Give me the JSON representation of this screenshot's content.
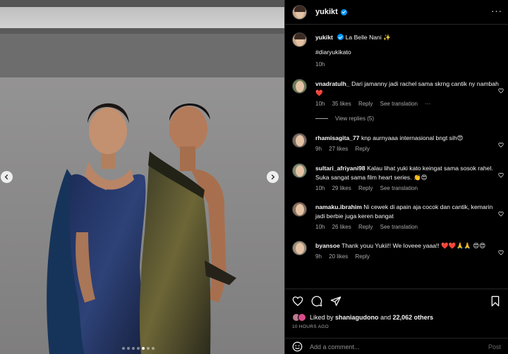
{
  "post": {
    "username": "yukikt",
    "more_icon": "more-horizontal-icon",
    "caption_line1": "La Belle Nani ✨",
    "caption_line2": "#diaryukikato",
    "caption_time": "10h"
  },
  "media": {
    "alt": "Two women in gowns posing",
    "carousel_total": 7,
    "carousel_active": 4
  },
  "comments": [
    {
      "user": "vnadratulh_",
      "text": "Dari jamanny jadi rachel sama skrng cantik ny nambah ❤️",
      "time": "10h",
      "likes": "35 likes",
      "reply": "Reply",
      "translate": "See translation",
      "more": "···",
      "view_replies": "View replies (5)"
    },
    {
      "user": "rhamisagita_77",
      "text": "knp aurnyaaa internasional bngt sih😍",
      "time": "9h",
      "likes": "27 likes",
      "reply": "Reply"
    },
    {
      "user": "sultari_afriyani98",
      "text": "Kalau lihat yuki kato keingat sama sosok rahel. Suka sangat sama film heart series. 👏😍",
      "time": "10h",
      "likes": "29 likes",
      "reply": "Reply",
      "translate": "See translation"
    },
    {
      "user": "namaku.ibrahim",
      "text": "Ni cewek di apain aja cocok dan cantik, kemarin jadi berbie juga keren bangat",
      "time": "10h",
      "likes": "26 likes",
      "reply": "Reply",
      "translate": "See translation"
    },
    {
      "user": "byansoe",
      "text": "Thank youu Yukii!! We loveee yaaa!! ❤️❤️🙏🙏 😍😍",
      "time": "9h",
      "likes": "20 likes",
      "reply": "Reply"
    }
  ],
  "actions": {
    "liked_prefix": "Liked by",
    "liked_user": "shaniagudono",
    "liked_and": "and",
    "liked_count": "22,062 others",
    "timestamp": "10 HOURS AGO",
    "add_comment_placeholder": "Add a comment...",
    "post_label": "Post"
  },
  "colors": {
    "verified": "#0095f6",
    "heart": "#ed4956",
    "background": "#000000",
    "muted": "#a8a8a8"
  }
}
